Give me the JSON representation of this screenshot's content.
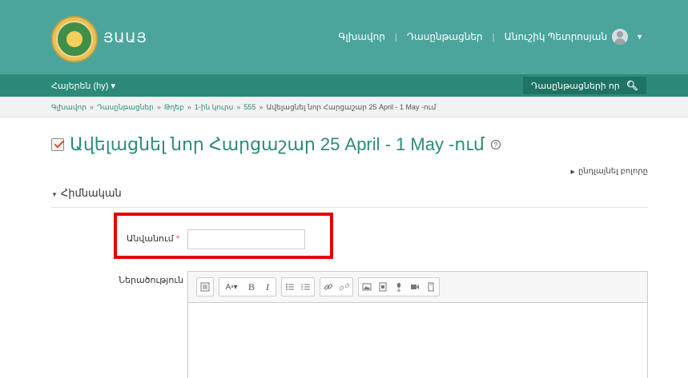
{
  "header": {
    "brand": "ՅԱԱՅ",
    "nav": [
      "Գլխավոր",
      "Դասընթացներ",
      "Անուշիկ Պետրոսյան"
    ],
    "accent": "#4ba59d"
  },
  "subbar": {
    "language": "Հայերեն (hy) ▾",
    "search_label": "Դասընթացների որ",
    "search_icon": "search-icon"
  },
  "breadcrumb": {
    "items": [
      "Գլխավոր",
      "Դասընթացներ",
      "Թղեբ",
      "1-ին կուրս",
      "555",
      "Ավելացնել նոր Հարցաշար 25 April - 1 May -ում"
    ]
  },
  "page": {
    "title": "Ավելացնել նոր Հարցաշար 25 April - 1 May -ում",
    "expand_all": "ընդլայնել բոլորը",
    "section": "Հիմնական"
  },
  "form": {
    "name_label": "Անվանում",
    "name_value": "",
    "description_label": "Ներածություն",
    "required_marker": "*"
  },
  "editor": {
    "toolbar": [
      "collapse-icon",
      "font-size-icon",
      "bold-icon",
      "italic-icon",
      "bullet-list-icon",
      "numbered-list-icon",
      "link-icon",
      "unlink-icon",
      "image-icon",
      "media-icon",
      "record-audio-icon",
      "record-video-icon",
      "manage-files-icon"
    ]
  }
}
